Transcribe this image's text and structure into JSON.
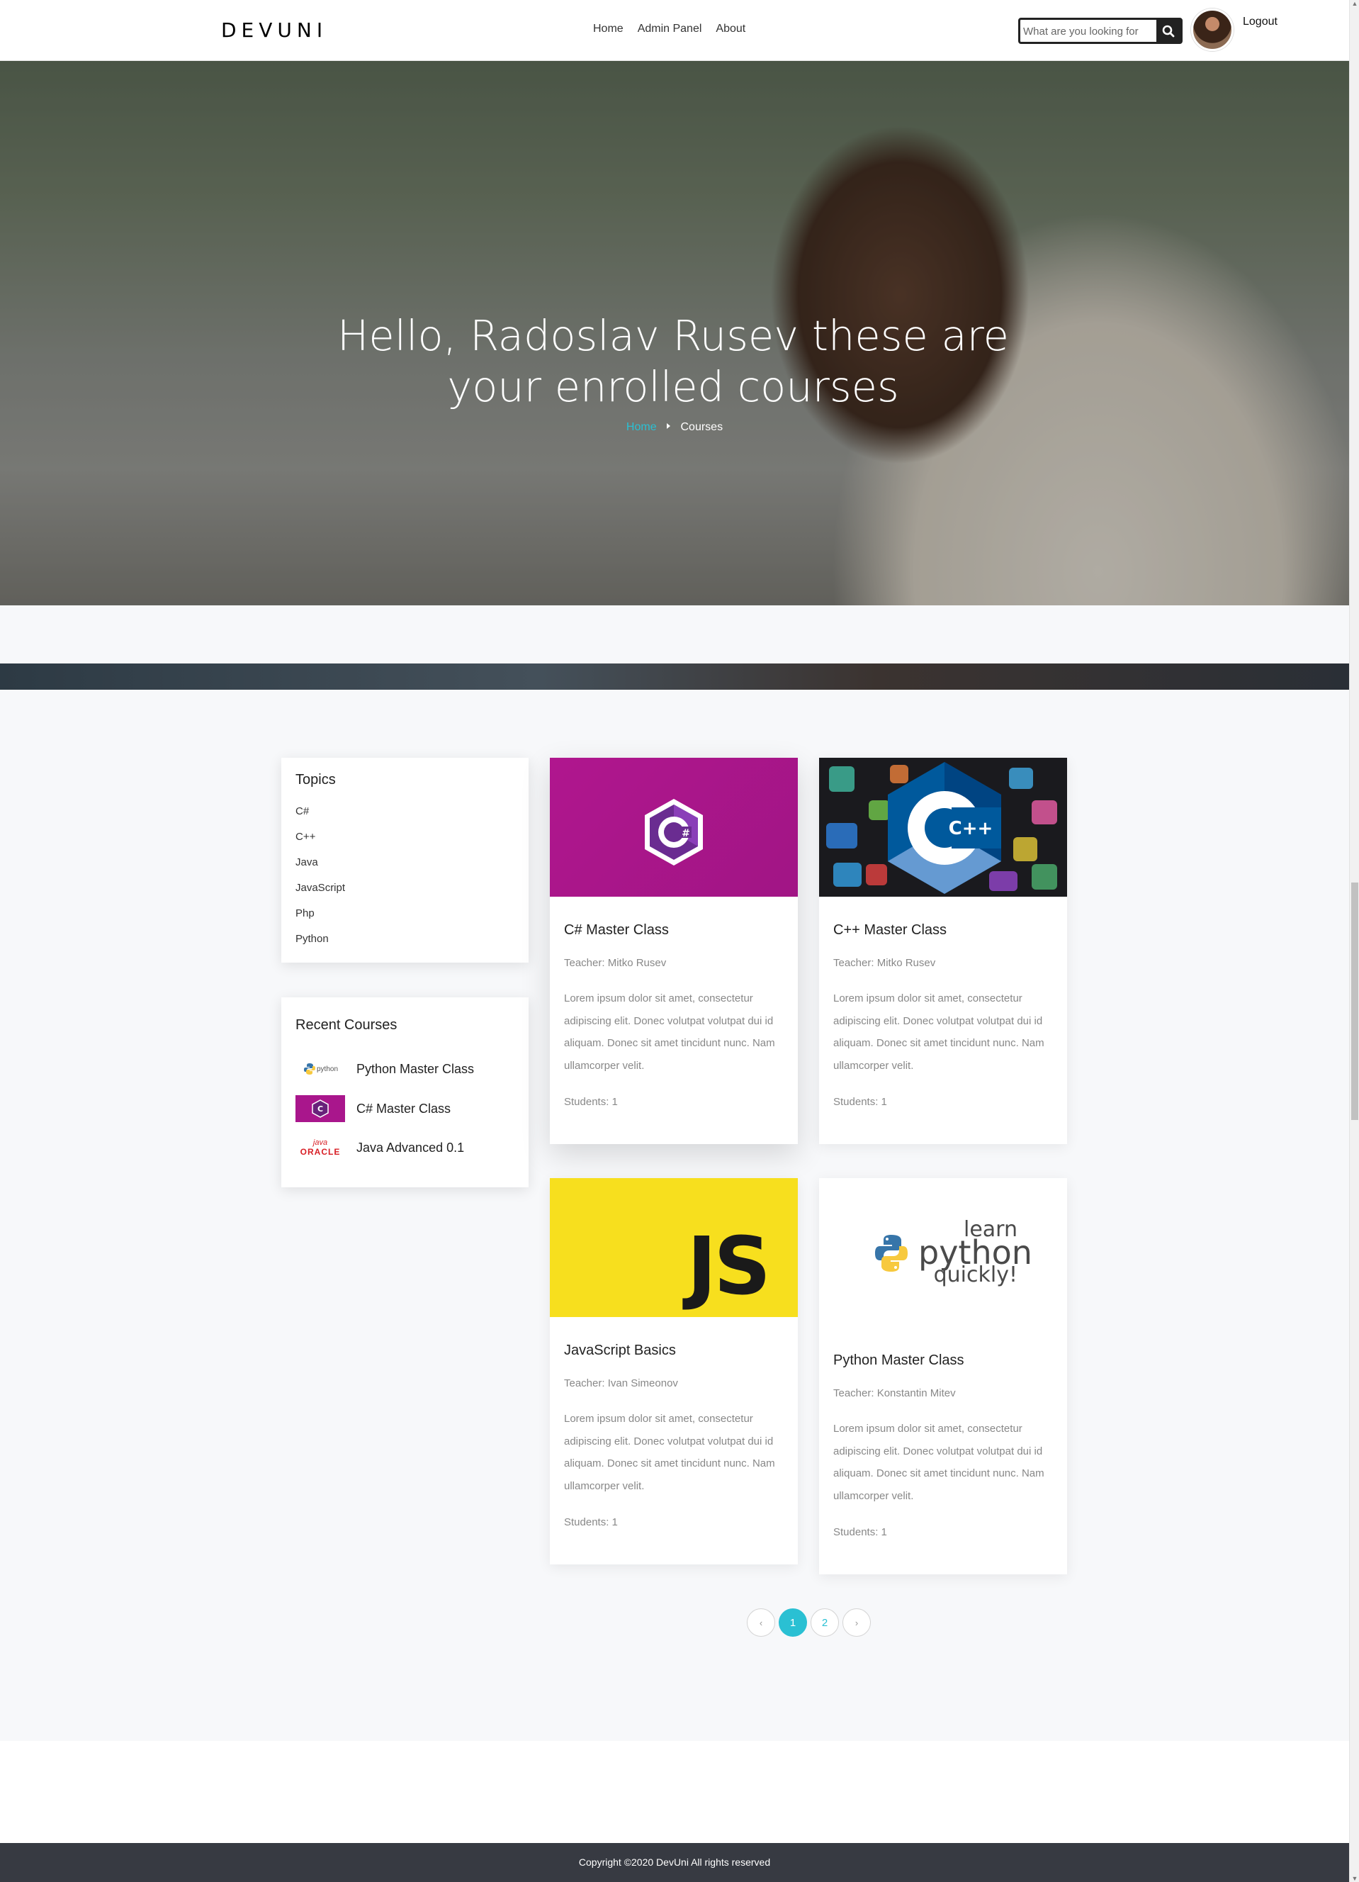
{
  "header": {
    "logo": "DEVUNI",
    "nav": [
      "Home",
      "Admin Panel",
      "About"
    ],
    "search_placeholder": "What are you looking for",
    "logout": "Logout"
  },
  "hero": {
    "title": "Hello, Radoslav Rusev these are your enrolled courses",
    "breadcrumb": {
      "home": "Home",
      "current": "Courses"
    }
  },
  "sidebar": {
    "topics_title": "Topics",
    "topics": [
      "C#",
      "C++",
      "Java",
      "JavaScript",
      "Php",
      "Python"
    ],
    "recent_title": "Recent Courses",
    "recent": [
      {
        "title": "Python Master Class",
        "thumb": "python-icon"
      },
      {
        "title": "C# Master Class",
        "thumb": "csharp-icon"
      },
      {
        "title": "Java Advanced 0.1",
        "thumb": "java-oracle-icon"
      }
    ],
    "java_thumb": {
      "brand": "java",
      "company": "ORACLE"
    },
    "python_thumb": "python"
  },
  "courses": [
    {
      "title": "C# Master Class",
      "teacher": "Teacher: Mitko Rusev",
      "description": "Lorem ipsum dolor sit amet, consectetur adipiscing elit. Donec volutpat volutpat dui id aliquam. Donec sit amet tincidunt nunc. Nam ullamcorper velit.",
      "students": "Students: 1",
      "image": "csharp-logo"
    },
    {
      "title": "C++ Master Class",
      "teacher": "Teacher: Mitko Rusev",
      "description": "Lorem ipsum dolor sit amet, consectetur adipiscing elit. Donec volutpat volutpat dui id aliquam. Donec sit amet tincidunt nunc. Nam ullamcorper velit.",
      "students": "Students: 1",
      "image": "cpp-logo",
      "logo_text": "C++"
    },
    {
      "title": "JavaScript Basics",
      "teacher": "Teacher: Ivan Simeonov",
      "description": "Lorem ipsum dolor sit amet, consectetur adipiscing elit. Donec volutpat volutpat dui id aliquam. Donec sit amet tincidunt nunc. Nam ullamcorper velit.",
      "students": "Students: 1",
      "image": "js-logo",
      "logo_text": "JS"
    },
    {
      "title": "Python Master Class",
      "teacher": "Teacher: Konstantin Mitev",
      "description": "Lorem ipsum dolor sit amet, consectetur adipiscing elit. Donec volutpat volutpat dui id aliquam. Donec sit amet tincidunt nunc. Nam ullamcorper velit.",
      "students": "Students: 1",
      "image": "learn-python-quickly-logo",
      "logo_lines": [
        "learn",
        "python",
        "quickly!"
      ]
    }
  ],
  "pagination": {
    "prev": "‹",
    "pages": [
      "1",
      "2"
    ],
    "next": "›",
    "active": "1"
  },
  "footer": {
    "copyright": "Copyright ©2020 DevUni All rights reserved"
  },
  "colors": {
    "accent": "#2ac0d3",
    "footer_bg": "#373a42",
    "csharp_bg": "#a9168c",
    "js_bg": "#f7df1e"
  }
}
